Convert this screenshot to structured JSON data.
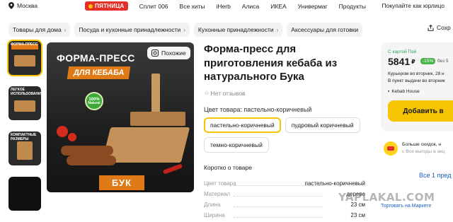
{
  "topbar": {
    "location": "Москва",
    "links": [
      "Сплит 006",
      "Все хиты",
      "iHerb",
      "Алиса",
      "ИКЕА",
      "Универмаг",
      "Продукты"
    ],
    "brand_badge": "ПЯТНИЦА",
    "right_text": "Покупайте как юрлицо"
  },
  "breadcrumbs": [
    "Товары для дома",
    "Посуда и кухонные принадлежности",
    "Кухонные принадлежности",
    "Аксессуары для готовки"
  ],
  "share_label": "Сохр",
  "gallery": {
    "similar_label": "Похожие",
    "hero_title": "ФОРМА-ПРЕСС",
    "hero_subtitle": "ДЛЯ КЕБАБА",
    "hero_badge_top": "100%",
    "hero_badge_bottom": "Natural",
    "hero_bottom": "БУК",
    "thumb_texts": [
      "ФОРМА-ПРЕСС",
      "ЛЕГКОЕ ИСПОЛЬЗОВАНИЕ",
      "КОМПАКТНЫЕ РАЗМЕРЫ"
    ]
  },
  "product": {
    "title": "Форма-пресс для приготовления кебаба из натурального Бука",
    "reviews": "Нет отзывов",
    "color_label": "Цвет товара: пастельно-коричневый",
    "colors": [
      {
        "label": "пастельно-коричневый",
        "selected": true
      },
      {
        "label": "пудровый коричневый",
        "selected": false
      },
      {
        "label": "темно-коричневый",
        "selected": false
      }
    ],
    "about_label": "Коротко о товаре",
    "specs": [
      {
        "name": "Цвет товара",
        "value": "пастельно-коричневый"
      },
      {
        "name": "Материал",
        "value": "дерево"
      },
      {
        "name": "Длина",
        "value": "23 см"
      },
      {
        "name": "Ширина",
        "value": "23 см"
      }
    ]
  },
  "buybox": {
    "card_label": "С картой Пэй",
    "price": "5841",
    "currency": "₽",
    "discount": "-15%",
    "old_price": "без 5",
    "delivery_line1": "Курьером во вторник, 28 н",
    "delivery_line2": "В пункт выдачи во вторник",
    "seller": "Kebab House",
    "add_button": "Добавить в"
  },
  "promo": {
    "line1": "Больше скидок, н",
    "line2": "с Все выгоды в акц"
  },
  "offers_link": "Все 1 пред",
  "market_link": "Торговать на Маркете",
  "watermark": "YAPLAKAL.COM",
  "colors": {
    "accent": "#f6c400",
    "brand_red": "#e5302a",
    "link": "#1a5fc7",
    "discount_green": "#4bb34b"
  }
}
